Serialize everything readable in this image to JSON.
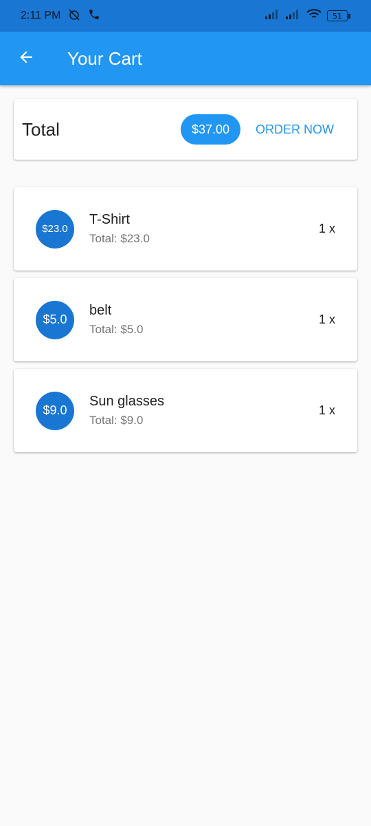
{
  "status_bar": {
    "time": "2:11 PM",
    "battery": "51"
  },
  "app_bar": {
    "title": "Your Cart"
  },
  "summary": {
    "label": "Total",
    "amount": "$37.00",
    "order_button": "ORDER NOW"
  },
  "items": [
    {
      "price": "$23.0",
      "name": "T-Shirt",
      "total": "Total: $23.0",
      "qty": "1 x"
    },
    {
      "price": "$5.0",
      "name": "belt",
      "total": "Total: $5.0",
      "qty": "1 x"
    },
    {
      "price": "$9.0",
      "name": "Sun glasses",
      "total": "Total: $9.0",
      "qty": "1 x"
    }
  ],
  "colors": {
    "primary": "#2196f3",
    "primary_dark": "#1976d2",
    "background": "#fafafa"
  }
}
